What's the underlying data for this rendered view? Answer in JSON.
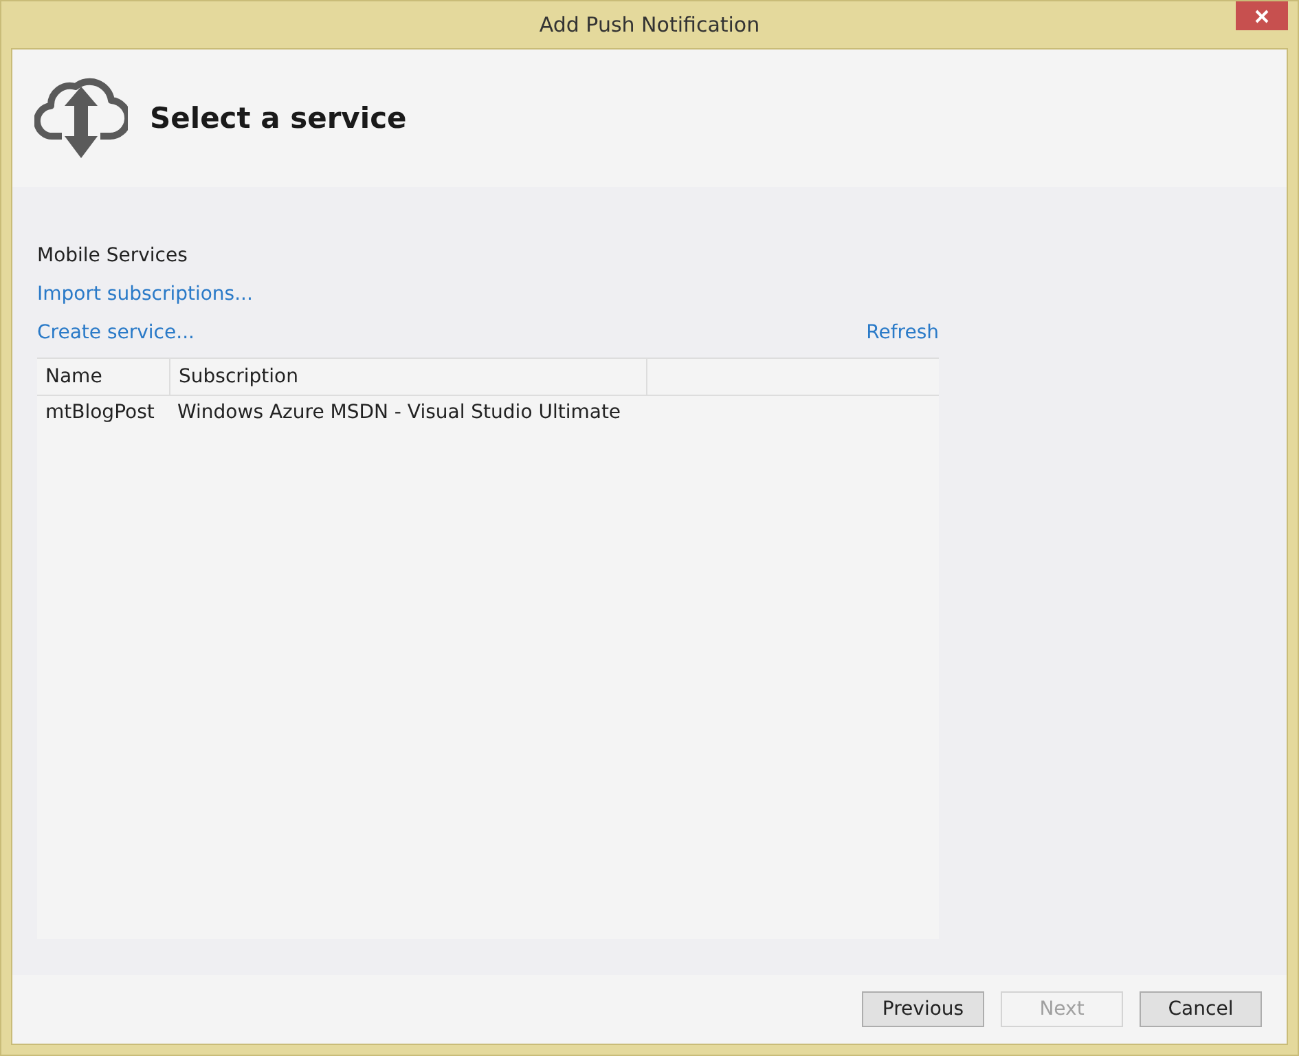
{
  "window": {
    "title": "Add Push Notification"
  },
  "header": {
    "title": "Select a service"
  },
  "section_label": "Mobile Services",
  "links": {
    "import": "Import subscriptions...",
    "create": "Create service...",
    "refresh": "Refresh"
  },
  "table": {
    "columns": [
      "Name",
      "Subscription"
    ],
    "rows": [
      {
        "name": "mtBlogPost",
        "subscription": "Windows Azure MSDN - Visual Studio Ultimate"
      }
    ]
  },
  "buttons": [
    {
      "label": "Previous",
      "disabled": false
    },
    {
      "label": "Next",
      "disabled": true
    },
    {
      "label": "Cancel",
      "disabled": false
    }
  ]
}
